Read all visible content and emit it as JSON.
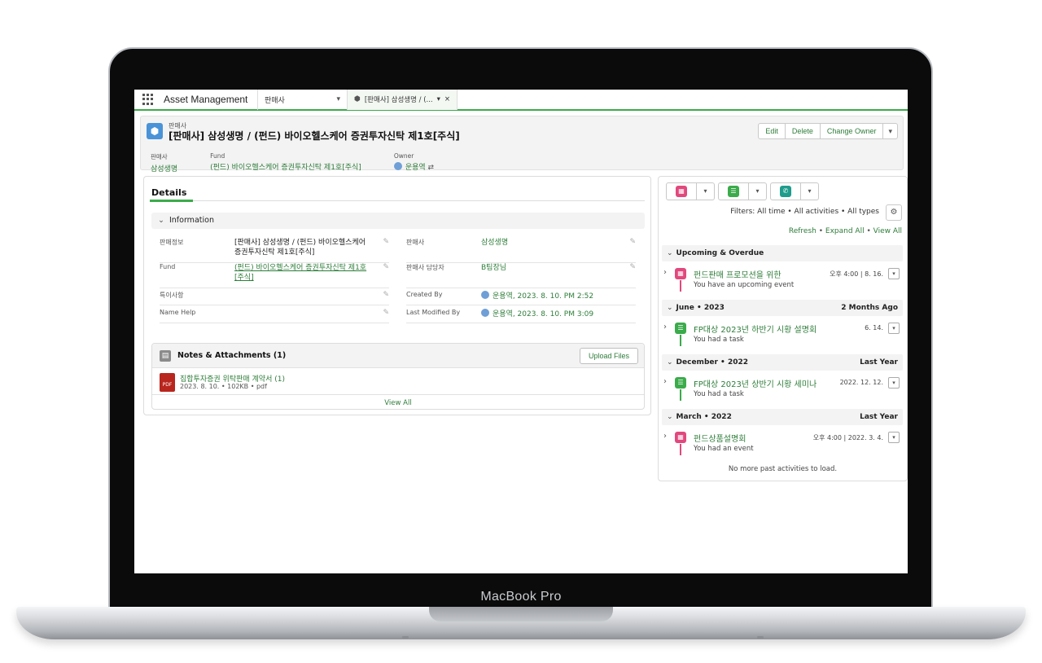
{
  "device": {
    "label": "MacBook Pro"
  },
  "topbar": {
    "app_name": "Asset Management",
    "nav_object": "판매사",
    "tab_label": "[판매사] 삼성생명 / (...",
    "tab_close": "×"
  },
  "record": {
    "type": "판매사",
    "title": "[판매사] 삼성생명 / (펀드) 바이오헬스케어 증권투자신탁 제1호[주식]",
    "actions": {
      "edit": "Edit",
      "delete": "Delete",
      "change_owner": "Change Owner"
    },
    "highlights": [
      {
        "label": "판매사",
        "value": "삼성생명"
      },
      {
        "label": "Fund",
        "value": "(펀드) 바이오헬스케어 증권투자신탁 제1호[주식]"
      },
      {
        "label": "Owner",
        "value": "운용역"
      }
    ]
  },
  "details": {
    "tab": "Details",
    "section": "Information",
    "fields": {
      "info_label": "판매정보",
      "info_value": "[판매사] 삼성생명 / (펀드) 바이오헬스케어 증권투자신탁 제1호[주식]",
      "fund_label": "Fund",
      "fund_value": "(펀드) 바이오헬스케어 증권투자신탁 제1호[주식]",
      "note_label": "특이사항",
      "namehelp_label": "Name Help",
      "seller_label": "판매사",
      "seller_value": "삼성생명",
      "manager_label": "판매사 담당자",
      "manager_value": "B팀장님",
      "created_label": "Created By",
      "created_value": "운용역, 2023. 8. 10. PM 2:52",
      "modified_label": "Last Modified By",
      "modified_value": "운용역, 2023. 8. 10. PM 3:09"
    }
  },
  "notes": {
    "title": "Notes & Attachments (1)",
    "upload": "Upload Files",
    "file_type": "PDF",
    "file_name": "집합투자증권 위탁판매 계약서 (1)",
    "file_meta": "2023. 8. 10. • 102KB • pdf",
    "view_all": "View All"
  },
  "activity": {
    "filters": "Filters: All time • All activities • All types",
    "links": {
      "refresh": "Refresh",
      "expand_all": "Expand All",
      "view_all": "View All",
      "sep": " • "
    },
    "groups": [
      {
        "label": "Upcoming & Overdue",
        "right": ""
      },
      {
        "label": "June • 2023",
        "right": "2 Months Ago"
      },
      {
        "label": "December • 2022",
        "right": "Last Year"
      },
      {
        "label": "March • 2022",
        "right": "Last Year"
      }
    ],
    "items": [
      {
        "title": "펀드판매 프로모션을 위한",
        "sub": "You have an upcoming event",
        "date": "오후 4:00 | 8. 16.",
        "kind": "event"
      },
      {
        "title": "FP대상 2023년 하반기 시황 설명회",
        "sub": "You had a task",
        "date": "6. 14.",
        "kind": "task"
      },
      {
        "title": "FP대상 2023년 상반기 시황 세미나",
        "sub": "You had a task",
        "date": "2022. 12. 12.",
        "kind": "task"
      },
      {
        "title": "펀드상품설명회",
        "sub": "You had an event",
        "date": "오후 4:00 | 2022. 3. 4.",
        "kind": "event"
      }
    ],
    "no_more": "No more past activities to load."
  },
  "colors": {
    "brand_green": "#3bab4b",
    "link_green": "#2e7d3a",
    "event_pink": "#e2487d",
    "task_green": "#3bab4b",
    "call_teal": "#1f9c8c",
    "record_blue": "#4a93d8"
  }
}
